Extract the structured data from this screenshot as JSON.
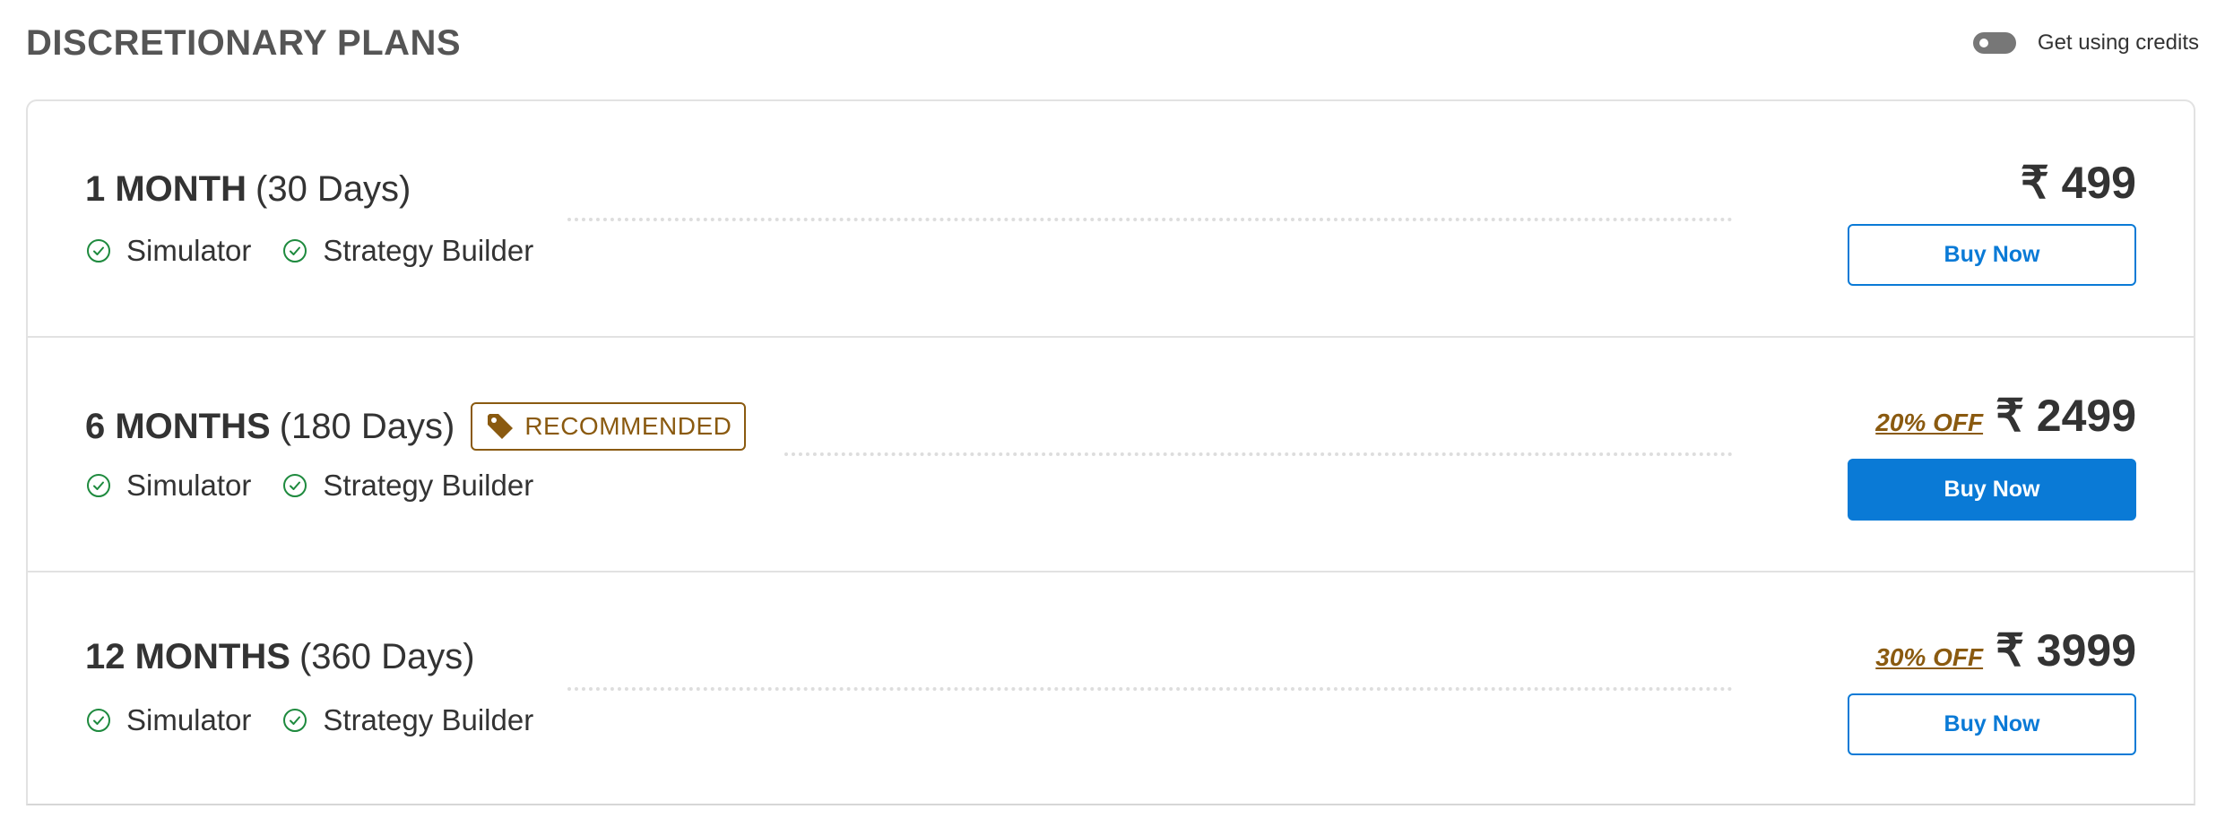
{
  "header": {
    "title": "DISCRETIONARY PLANS",
    "credits_toggle_label": "Get using credits",
    "credits_toggle_on": false
  },
  "colors": {
    "primary": "#0a7ad6",
    "discount": "#8a5a10",
    "check": "#1e8a3e",
    "text": "#333333"
  },
  "plans": [
    {
      "duration": "1 MONTH",
      "days": "(30 Days)",
      "features": [
        "Simulator",
        "Strategy Builder"
      ],
      "discount": "",
      "price": "₹ 499",
      "button_label": "Buy Now",
      "button_style": "outline",
      "recommended": false
    },
    {
      "duration": "6 MONTHS",
      "days": "(180 Days)",
      "features": [
        "Simulator",
        "Strategy Builder"
      ],
      "badge": "RECOMMENDED",
      "discount": "20% OFF",
      "price": "₹ 2499",
      "button_label": "Buy Now",
      "button_style": "filled",
      "recommended": true
    },
    {
      "duration": "12 MONTHS",
      "days": "(360 Days)",
      "features": [
        "Simulator",
        "Strategy Builder"
      ],
      "discount": "30% OFF",
      "price": "₹ 3999",
      "button_label": "Buy Now",
      "button_style": "outline",
      "recommended": false
    }
  ]
}
